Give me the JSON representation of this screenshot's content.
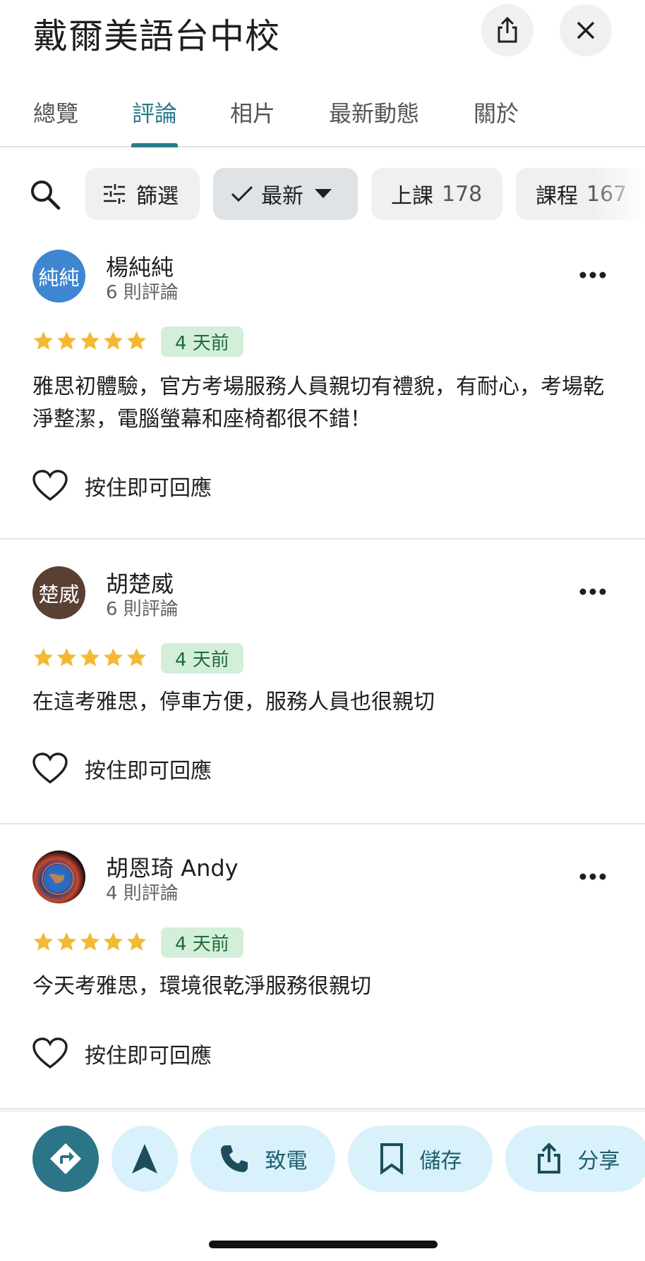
{
  "header": {
    "title": "戴爾美語台中校",
    "share_icon": "share-icon",
    "close_icon": "close-icon"
  },
  "tabs": [
    {
      "label": "總覽",
      "active": false
    },
    {
      "label": "評論",
      "active": true
    },
    {
      "label": "相片",
      "active": false
    },
    {
      "label": "最新動態",
      "active": false
    },
    {
      "label": "關於",
      "active": false
    }
  ],
  "filters": {
    "filter_label": "篩選",
    "sort_label": "最新",
    "chips": [
      {
        "label": "上課",
        "count": "178"
      },
      {
        "label": "課程",
        "count": "167"
      }
    ]
  },
  "reviews": [
    {
      "avatar_text": "純純",
      "avatar_color": "#3f86d0",
      "name": "楊純純",
      "count": "6 則評論",
      "rating": 5,
      "time": "4 天前",
      "text": "雅思初體驗，官方考場服務人員親切有禮貌，有耐心，考場乾淨整潔，電腦螢幕和座椅都很不錯！",
      "react_label": "按住即可回應"
    },
    {
      "avatar_text": "楚威",
      "avatar_color": "#5a3f33",
      "name": "胡楚威",
      "count": "6 則評論",
      "rating": 5,
      "time": "4 天前",
      "text": "在這考雅思，停車方便，服務人員也很親切",
      "react_label": "按住即可回應"
    },
    {
      "avatar_text": "",
      "avatar_color": "#0b1a3a",
      "name": "胡恩琦 Andy",
      "count": "4 則評論",
      "rating": 5,
      "time": "4 天前",
      "text": "今天考雅思，環境很乾淨服務很親切",
      "react_label": "按住即可回應"
    }
  ],
  "actions": {
    "call": "致電",
    "save": "儲存",
    "share": "分享"
  },
  "colors": {
    "accent": "#2a7a8c",
    "star": "#f3b935",
    "badge_bg": "#d4efd9",
    "action_bg": "#d8f1fb"
  }
}
